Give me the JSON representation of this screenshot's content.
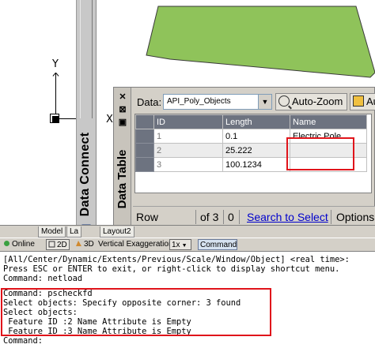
{
  "canvas": {
    "axis_y_label": "Y",
    "axis_x_label": "X",
    "polygon_color": "#8fc35a",
    "polygon_stroke": "#3a3a3a"
  },
  "data_connect": {
    "title": "Data Connect"
  },
  "data_table": {
    "title": "Data Table",
    "side_buttons": [
      "✕",
      "⊠",
      "▣"
    ],
    "data_label": "Data:",
    "data_source": "API_Poly_Objects",
    "toolbar": {
      "auto_zoom": "Auto-Zoom",
      "auto_select": "Auto-S"
    },
    "columns": [
      "ID",
      "Length",
      "Name"
    ],
    "rows": [
      {
        "id": "1",
        "length": "0.1",
        "name": "Electric Pole"
      },
      {
        "id": "2",
        "length": "25.222",
        "name": ""
      },
      {
        "id": "3",
        "length": "100.1234",
        "name": ""
      }
    ],
    "status": {
      "row_label": "Row",
      "of_label": "of 3",
      "count": "0",
      "search_link": "Search to Select",
      "options": "Options"
    }
  },
  "layout_tabs": [
    "Model",
    "La",
    "Layout2"
  ],
  "statusbar": {
    "online": "Online",
    "view_2d": "2D",
    "view_3d": "3D",
    "vertical_exaggeration_label": "Vertical Exaggeration:",
    "vertical_exaggeration_value": "1x",
    "command_tab": "Command"
  },
  "command_lines": [
    "[All/Center/Dynamic/Extents/Previous/Scale/Window/Object] <real time>:",
    "Press ESC or ENTER to exit, or right-click to display shortcut menu.",
    "Command: netload",
    "Command: pscheckfd",
    "Select objects: Specify opposite corner: 3 found",
    "Select objects:",
    " Feature ID :2 Name Attribute is Empty",
    " Feature ID :3 Name Attribute is Empty",
    "Command:"
  ],
  "colors": {
    "highlight": "#e0141b",
    "grid_header": "#6d7380",
    "link": "#0000cc"
  }
}
